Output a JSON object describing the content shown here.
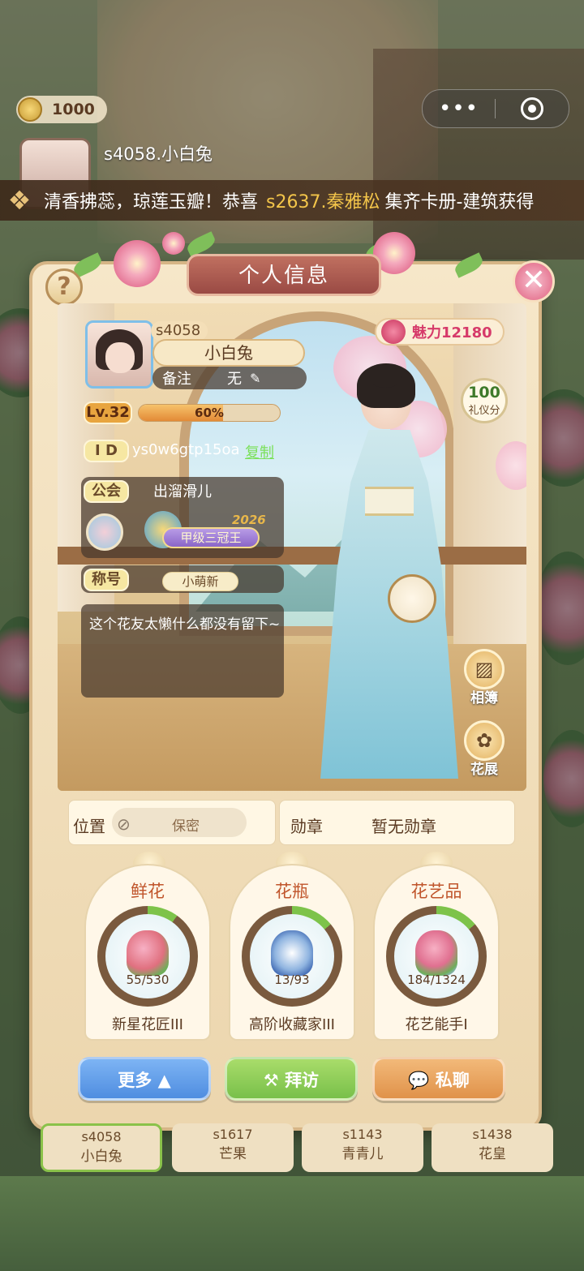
{
  "hud": {
    "coins": "1000",
    "menu_dots": "•••"
  },
  "bg_player": {
    "name": "s4058.小白兔"
  },
  "ticker": {
    "text1": "清香拂蕊，琼莲玉瓣！恭喜",
    "player": "s2637.秦雅松",
    "text2": "集齐卡册-建筑获得"
  },
  "panel": {
    "title": "个人信息",
    "help": "?",
    "close": "✕"
  },
  "profile": {
    "server": "s4058",
    "name": "小白兔",
    "remark_label": "备注",
    "remark_value": "无",
    "level": "Lv.32",
    "exp_percent": "60%",
    "exp_fraction": 0.6,
    "id_label": "I D",
    "id_value": "ys0w6gtp15oa",
    "copy": "复制",
    "guild_label": "公会",
    "guild_name": "出溜滑儿",
    "rank_badge": "甲级三冠王",
    "rank_year": "2026",
    "title_label": "称号",
    "title_value": "小萌新",
    "bio": "这个花友太懒什么都没有留下~"
  },
  "right": {
    "charm": "魅力12180",
    "etiquette_value": "100",
    "etiquette_label": "礼仪分",
    "album": "相簿",
    "exhibit": "花展"
  },
  "info": {
    "position_label": "位置",
    "position_value": "保密",
    "medal_label": "勋章",
    "medal_value": "暂无勋章"
  },
  "collections": [
    {
      "head": "鲜花",
      "count": "55/530",
      "foot": "新星花匠III",
      "progress": 0.1
    },
    {
      "head": "花瓶",
      "count": "13/93",
      "foot": "高阶收藏家III",
      "progress": 0.14
    },
    {
      "head": "花艺品",
      "count": "184/1324",
      "foot": "花艺能手I",
      "progress": 0.14
    }
  ],
  "actions": {
    "more": "更多",
    "visit": "拜访",
    "chat": "私聊"
  },
  "tabs": [
    {
      "server": "s4058",
      "name": "小白兔"
    },
    {
      "server": "s1617",
      "name": "芒果"
    },
    {
      "server": "s1143",
      "name": "青青儿"
    },
    {
      "server": "s1438",
      "name": "花皇"
    }
  ],
  "colors": {
    "accent": "#c0552b",
    "more_btn": "#4f8de0",
    "visit_btn": "#79c04a",
    "chat_btn": "#e0924a",
    "progress_green": "#7dc34a"
  }
}
